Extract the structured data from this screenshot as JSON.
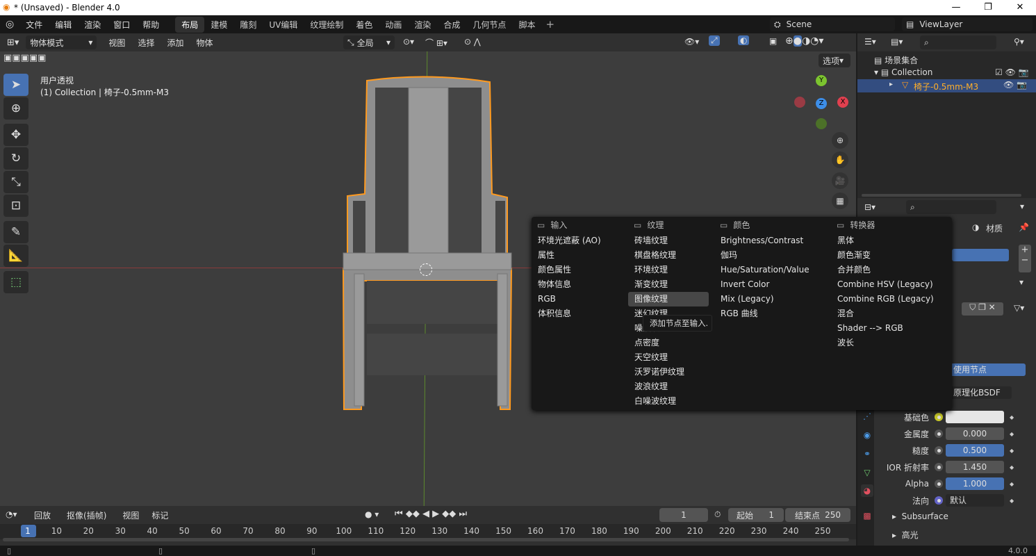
{
  "window": {
    "title": "* (Unsaved) - Blender 4.0",
    "minimize": "—",
    "maximize": "❐",
    "close": "✕"
  },
  "menu": [
    "文件",
    "编辑",
    "渲染",
    "窗口",
    "帮助"
  ],
  "workspaces": [
    "布局",
    "建模",
    "雕刻",
    "UV编辑",
    "纹理绘制",
    "着色",
    "动画",
    "渲染",
    "合成",
    "几何节点",
    "脚本"
  ],
  "workspace_active": 0,
  "scene": "Scene",
  "view_layer": "ViewLayer",
  "viewport_header": {
    "mode": "物体模式",
    "menus": [
      "视图",
      "选择",
      "添加",
      "物体"
    ],
    "transform": "全局",
    "options": "选项"
  },
  "viewport": {
    "view_name": "用户透视",
    "collection_info": "(1) Collection | 椅子-0.5mm-M3",
    "selection_color": "#ff9a1f"
  },
  "gizmo": {
    "x": "X",
    "y": "Y",
    "z": "Z"
  },
  "outliner": {
    "root": "场景集合",
    "collection": "Collection",
    "object": "椅子-0.5mm-M3"
  },
  "properties": {
    "breadcrumb_tab": "材质",
    "use_nodes": "使用节点",
    "surface": "原理化BSDF",
    "fields": [
      {
        "label": "基础色",
        "value": "",
        "type": "color"
      },
      {
        "label": "金属度",
        "value": "0.000",
        "type": "grey"
      },
      {
        "label": "糙度",
        "value": "0.500",
        "type": "blue"
      },
      {
        "label": "IOR 折射率",
        "value": "1.450",
        "type": "grey"
      },
      {
        "label": "Alpha",
        "value": "1.000",
        "type": "blue"
      },
      {
        "label": "法向",
        "value": "默认",
        "type": "dark"
      }
    ],
    "sections": [
      "Subsurface",
      "高光"
    ]
  },
  "add_menu": {
    "columns": [
      {
        "title": "输入",
        "items": [
          "环境光遮蔽 (AO)",
          "属性",
          "颜色属性",
          "物体信息",
          "RGB",
          "体积信息"
        ]
      },
      {
        "title": "纹理",
        "items": [
          "砖墙纹理",
          "棋盘格纹理",
          "环境纹理",
          "渐变纹理",
          "图像纹理",
          "迷幻纹理",
          "噪波纹理",
          "点密度",
          "天空纹理",
          "沃罗诺伊纹理",
          "波浪纹理",
          "白噪波纹理"
        ]
      },
      {
        "title": "颜色",
        "items": [
          "Brightness/Contrast",
          "伽玛",
          "Hue/Saturation/Value",
          "Invert Color",
          "Mix (Legacy)",
          "RGB 曲线"
        ]
      },
      {
        "title": "转换器",
        "items": [
          "黑体",
          "颜色渐变",
          "合并颜色",
          "Combine HSV (Legacy)",
          "Combine RGB (Legacy)",
          "混合",
          "Shader --> RGB",
          "波长"
        ]
      }
    ],
    "highlighted": "图像纹理",
    "tooltip": "添加节点至输入."
  },
  "timeline": {
    "menus": [
      "回放",
      "抠像(插帧)",
      "视图",
      "标记"
    ],
    "current_frame": "1",
    "start_label": "起始",
    "start": "1",
    "end_label": "结束点",
    "end": "250",
    "ticks": [
      "1",
      "10",
      "20",
      "30",
      "40",
      "50",
      "60",
      "70",
      "80",
      "90",
      "100",
      "110",
      "120",
      "130",
      "140",
      "150",
      "160",
      "170",
      "180",
      "190",
      "200",
      "210",
      "220",
      "230",
      "240",
      "250"
    ]
  },
  "status": {
    "version": "4.0.0"
  },
  "colors": {
    "accent": "#4772b3",
    "x_axis": "#e0404f",
    "y_axis": "#7cc42f",
    "z_axis": "#3d8ee8"
  }
}
